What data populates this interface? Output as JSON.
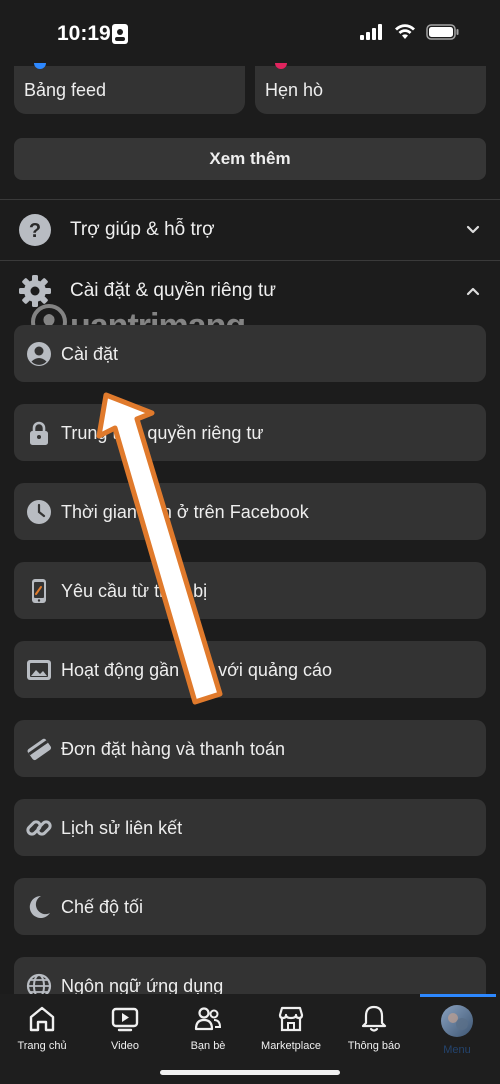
{
  "status": {
    "time": "10:19"
  },
  "shortcuts": [
    {
      "label": "Bảng feed",
      "dot_color": "#2d88ff"
    },
    {
      "label": "Hẹn hò",
      "dot_color": "#e0245e"
    }
  ],
  "see_more_label": "Xem thêm",
  "sections": {
    "help": {
      "label": "Trợ giúp & hỗ trợ"
    },
    "settings": {
      "label": "Cài đặt & quyền riêng tư"
    }
  },
  "menu_items": [
    {
      "label": "Cài đặt",
      "icon": "user-circle-icon"
    },
    {
      "label": "Trung tâm quyền riêng tư",
      "icon": "lock-icon"
    },
    {
      "label": "Thời gian bạn ở trên Facebook",
      "icon": "clock-icon"
    },
    {
      "label": "Yêu cầu từ thiết bị",
      "icon": "phone-icon"
    },
    {
      "label": "Hoạt động gần đây với quảng cáo",
      "icon": "image-icon"
    },
    {
      "label": "Đơn đặt hàng và thanh toán",
      "icon": "card-icon"
    },
    {
      "label": "Lịch sử liên kết",
      "icon": "link-icon"
    },
    {
      "label": "Chế độ tối",
      "icon": "moon-icon"
    },
    {
      "label": "Ngôn ngữ ứng dụng",
      "icon": "globe-icon"
    }
  ],
  "watermark": {
    "text": "uantrimang"
  },
  "tabs": [
    {
      "label": "Trang chủ",
      "icon": "home-icon"
    },
    {
      "label": "Video",
      "icon": "video-icon"
    },
    {
      "label": "Bạn bè",
      "icon": "friends-icon"
    },
    {
      "label": "Marketplace",
      "icon": "marketplace-icon"
    },
    {
      "label": "Thông báo",
      "icon": "bell-icon"
    },
    {
      "label": "Menu",
      "icon": "avatar-icon"
    }
  ],
  "colors": {
    "accent": "#2d88ff",
    "arrow": "#e07a2c",
    "background": "#1c1c1c",
    "card": "#333333"
  }
}
